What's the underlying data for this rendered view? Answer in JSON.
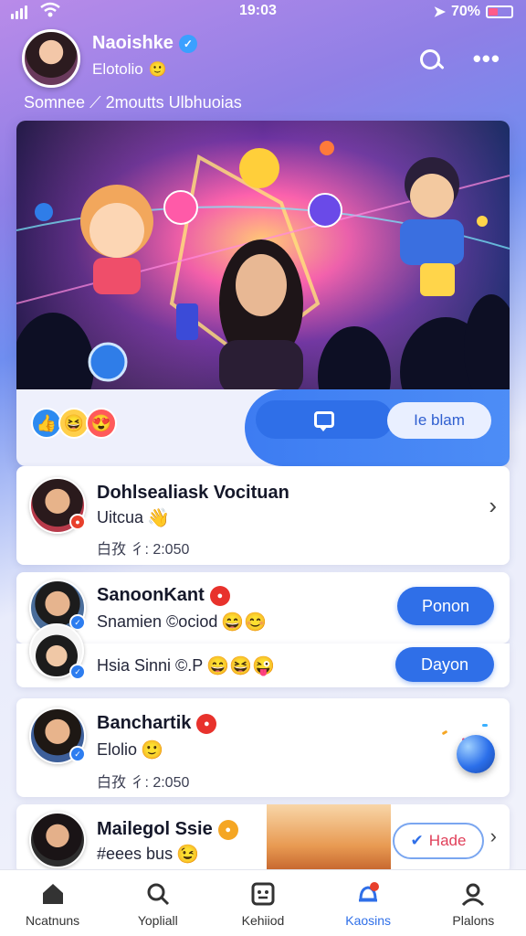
{
  "status_bar": {
    "time": "19:03",
    "battery": "70%"
  },
  "profile": {
    "name": "Naoishke",
    "subtitle": "Elotolio",
    "stats": "Somnee ⟋ 2moutts Ulbhuoias"
  },
  "hero": {
    "join_label": "Ie blam"
  },
  "list": [
    {
      "name": "Dohlsealiask Vocituan",
      "sub": "Uitcua",
      "time": "白孜 彳: 2:050",
      "action": "chevron"
    },
    {
      "name": "SanoonKant",
      "sub": "Snamien ©ociod",
      "action_label": "Ponon"
    },
    {
      "sub": "Hsia Sinni ©.P",
      "action_label": "Dayon"
    },
    {
      "name": "Banchartik",
      "sub": "Elolio",
      "time": "白孜 彳: 2:050"
    },
    {
      "name": "Mailegol Ssie",
      "sub": "#eees bus",
      "action_label": "Hade"
    }
  ],
  "nav": [
    {
      "label": "Ncatnuns",
      "icon": "home-icon"
    },
    {
      "label": "Yopliall",
      "icon": "search-icon"
    },
    {
      "label": "Kehiiod",
      "icon": "grid-icon"
    },
    {
      "label": "Kaosins",
      "icon": "notifications-icon",
      "active": true
    },
    {
      "label": "Plalons",
      "icon": "profile-icon"
    }
  ],
  "colors": {
    "accent": "#2f6fe8",
    "badge_red": "#e8402c"
  }
}
